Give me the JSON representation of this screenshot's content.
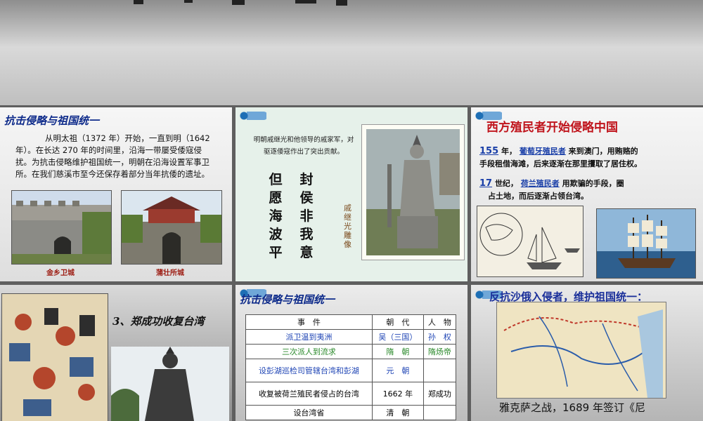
{
  "banner": {
    "ghost_text": ""
  },
  "slide1": {
    "title": "抗击侵略与祖国统一",
    "paragraph": "从明太祖（1372 年）开始，一直到明（1642 年）。在长达 270 年的时间里，沿海一带屡受倭寇侵扰。为抗击侵略维护祖国统一，明朝在沿海设置军事卫所。在我们慈溪市至今还保存着部分当年抗倭的遗址。",
    "captions": [
      "金乡卫城",
      "蒲壮所城"
    ]
  },
  "slide2": {
    "intro": "明朝戚继光和他领导的戚家军，对驱逐倭寇作出了突出贡献。",
    "poem_right": [
      "封",
      "侯",
      "非",
      "我",
      "意"
    ],
    "poem_left": [
      "但",
      "愿",
      "海",
      "波",
      "平"
    ],
    "statue_caption": "戚继光雕像"
  },
  "slide3": {
    "title": "西方殖民者开始侵略中国",
    "line1_blank": "155",
    "line1_mid": "年，",
    "line1_blank2": "葡萄牙殖民者",
    "line1_end": "来到澳门，用贿赂的",
    "line2": "手段租借海滩，后来逐渐在那里攫取了居住权。",
    "line3_blank": "17",
    "line3_mid": "世纪，",
    "line3_blank2": "荷兰殖民者",
    "line3_end": "用欺骗的手段，圈",
    "line4": "占土地，而后逐渐占领台湾。"
  },
  "slide4": {
    "title": "3、郑成功收复台湾"
  },
  "slide5": {
    "title": "抗击侵略与祖国统一",
    "headers": [
      "事　件",
      "朝　代",
      "人　物"
    ],
    "rows": [
      {
        "event": "派卫温到夷洲",
        "dynasty": "吴（三国）",
        "person": "孙　权",
        "cls": "c-blue"
      },
      {
        "event": "三次派人到流求",
        "dynasty": "隋　朝",
        "person": "隋炀帝",
        "cls": "c-green"
      },
      {
        "event": "设彭湖巡检司管辖台湾和彭湖",
        "dynasty": "元　朝",
        "person": "",
        "cls": "c-blue"
      },
      {
        "event": "收复被荷兰殖民者侵占的台湾",
        "dynasty": "1662 年",
        "person": "郑成功",
        "cls": ""
      },
      {
        "event": "设台湾省",
        "dynasty": "清　朝",
        "person": "",
        "cls": ""
      }
    ]
  },
  "slide6": {
    "title": "反抗沙俄入侵者，维护祖国统一：",
    "text": "雅克萨之战，1689 年签订《尼"
  }
}
